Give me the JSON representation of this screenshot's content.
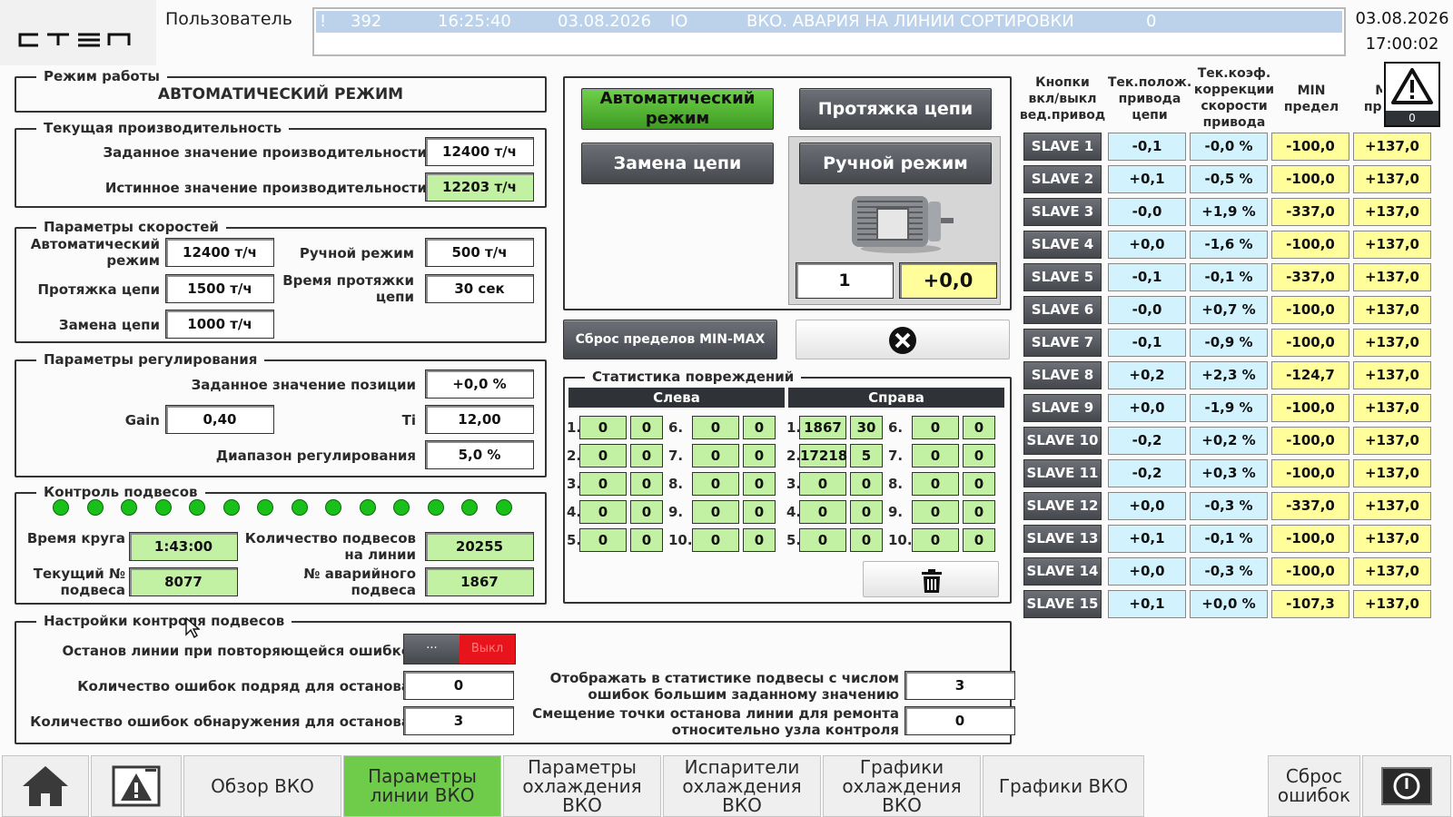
{
  "header": {
    "user_label": "Пользователь",
    "logo": "стэп",
    "alarm": {
      "flag": "!",
      "number": "392",
      "time": "16:25:40",
      "date": "03.08.2026",
      "code": "IO",
      "message": "ВКО. АВАРИЯ НА ЛИНИИ СОРТИРОВКИ",
      "count": "0"
    },
    "clock_date": "03.08.2026",
    "clock_time": "17:00:02",
    "warn_count": "0"
  },
  "mode": {
    "legend": "Режим работы",
    "value": "АВТОМАТИЧЕСКИЙ РЕЖИМ"
  },
  "productivity": {
    "legend": "Текущая производительность",
    "set_label": "Заданное значение производительности",
    "set_value": "12400 т/ч",
    "actual_label": "Истинное значение производительности",
    "actual_value": "12203 т/ч"
  },
  "speeds": {
    "legend": "Параметры скоростей",
    "auto_label": "Автоматический режим",
    "auto_value": "12400 т/ч",
    "manual_label": "Ручной режим",
    "manual_value": "500 т/ч",
    "pull_label": "Протяжка цепи",
    "pull_value": "1500 т/ч",
    "pull_time_label": "Время протяжки цепи",
    "pull_time_value": "30 сек",
    "replace_label": "Замена цепи",
    "replace_value": "1000 т/ч"
  },
  "regulation": {
    "legend": "Параметры регулирования",
    "pos_label": "Заданное значение позиции",
    "pos_value": "+0,0 %",
    "gain_label": "Gain",
    "gain_value": "0,40",
    "ti_label": "Ti",
    "ti_value": "12,00",
    "range_label": "Диапазон регулирования",
    "range_value": "5,0 %"
  },
  "hangers": {
    "legend": "Контроль подвесов",
    "lap_label": "Время круга",
    "lap_value": "1:43:00",
    "count_label": "Количество подвесов на линии",
    "count_value": "20255",
    "current_label": "Текущий № подвеса",
    "current_value": "8077",
    "alarm_label": "№ аварийного подвеса",
    "alarm_value": "1867"
  },
  "settings": {
    "legend": "Настройки контроля подвесов",
    "stop_label": "Останов линии при повторяющейся ошибке",
    "toggle_left": "···",
    "toggle_right": "Выкл",
    "consec_label": "Количество ошибок подряд для останова",
    "consec_value": "0",
    "detect_label": "Количество ошибок обнаружения для останова",
    "detect_value": "3",
    "show_label": "Отображать в статистике подвесы с числом ошибок большим заданному значению",
    "show_value": "3",
    "offset_label": "Смещение точки останова линии для ремонта относительно узла контроля",
    "offset_value": "0"
  },
  "controls": {
    "auto_btn": "Автоматический режим",
    "pull_btn": "Протяжка цепи",
    "replace_btn": "Замена цепи",
    "manual_btn": "Ручной режим",
    "drive_no": "1",
    "drive_val": "+0,0",
    "reset_btn": "Сброс пределов MIN-MAX"
  },
  "stats": {
    "legend": "Статистика повреждений",
    "left_label": "Слева",
    "right_label": "Справа",
    "left": [
      [
        "1.",
        "0",
        "0",
        "6.",
        "0",
        "0"
      ],
      [
        "2.",
        "0",
        "0",
        "7.",
        "0",
        "0"
      ],
      [
        "3.",
        "0",
        "0",
        "8.",
        "0",
        "0"
      ],
      [
        "4.",
        "0",
        "0",
        "9.",
        "0",
        "0"
      ],
      [
        "5.",
        "0",
        "0",
        "10.",
        "0",
        "0"
      ]
    ],
    "right": [
      [
        "1.",
        "1867",
        "30",
        "6.",
        "0",
        "0"
      ],
      [
        "2.",
        "17218",
        "5",
        "7.",
        "0",
        "0"
      ],
      [
        "3.",
        "0",
        "0",
        "8.",
        "0",
        "0"
      ],
      [
        "4.",
        "0",
        "0",
        "9.",
        "0",
        "0"
      ],
      [
        "5.",
        "0",
        "0",
        "10.",
        "0",
        "0"
      ]
    ]
  },
  "table": {
    "headers": [
      "Кнопки вкл/выкл вед.привод",
      "Тек.полож. привода цепи",
      "Тек.коэф. коррекции скорости привода",
      "MIN предел",
      "MAX предел"
    ],
    "rows": [
      [
        "SLAVE 1",
        "-0,1",
        "-0,0 %",
        "-100,0",
        "+137,0"
      ],
      [
        "SLAVE 2",
        "+0,1",
        "-0,5 %",
        "-100,0",
        "+137,0"
      ],
      [
        "SLAVE 3",
        "-0,0",
        "+1,9 %",
        "-337,0",
        "+137,0"
      ],
      [
        "SLAVE 4",
        "+0,0",
        "-1,6 %",
        "-100,0",
        "+137,0"
      ],
      [
        "SLAVE 5",
        "-0,1",
        "-0,1 %",
        "-337,0",
        "+137,0"
      ],
      [
        "SLAVE 6",
        "-0,0",
        "+0,7 %",
        "-100,0",
        "+137,0"
      ],
      [
        "SLAVE 7",
        "-0,1",
        "-0,9 %",
        "-100,0",
        "+137,0"
      ],
      [
        "SLAVE 8",
        "+0,2",
        "+2,3 %",
        "-124,7",
        "+137,0"
      ],
      [
        "SLAVE 9",
        "+0,0",
        "-1,9 %",
        "-100,0",
        "+137,0"
      ],
      [
        "SLAVE 10",
        "-0,2",
        "+0,2 %",
        "-100,0",
        "+137,0"
      ],
      [
        "SLAVE 11",
        "-0,2",
        "+0,3 %",
        "-100,0",
        "+137,0"
      ],
      [
        "SLAVE 12",
        "+0,0",
        "-0,3 %",
        "-337,0",
        "+137,0"
      ],
      [
        "SLAVE 13",
        "+0,1",
        "-0,1 %",
        "-100,0",
        "+137,0"
      ],
      [
        "SLAVE 14",
        "+0,0",
        "-0,3 %",
        "-100,0",
        "+137,0"
      ],
      [
        "SLAVE 15",
        "+0,1",
        "+0,0 %",
        "-107,3",
        "+137,0"
      ]
    ]
  },
  "nav": {
    "overview": "Обзор ВКО",
    "params": "Параметры линии ВКО",
    "cooling_params": "Параметры охлаждения ВКО",
    "evaporators": "Испарители охлаждения ВКО",
    "cooling_charts": "Графики охлаждения ВКО",
    "charts": "Графики ВКО",
    "reset": "Сброс ошибок"
  },
  "icons": [
    "home-icon",
    "alarm-screen-icon",
    "warning-icon",
    "close-circle-icon",
    "trash-icon",
    "motor-icon",
    "power-icon",
    "mouse-cursor-icon"
  ],
  "colors": {
    "accent_green": "#6fcc4a",
    "field_green": "#c2f1a3",
    "field_yellow": "#fffe9a",
    "field_blue": "#d2f2fe",
    "alarm_bar": "#bcd2ea",
    "off_red": "#e8141c"
  }
}
